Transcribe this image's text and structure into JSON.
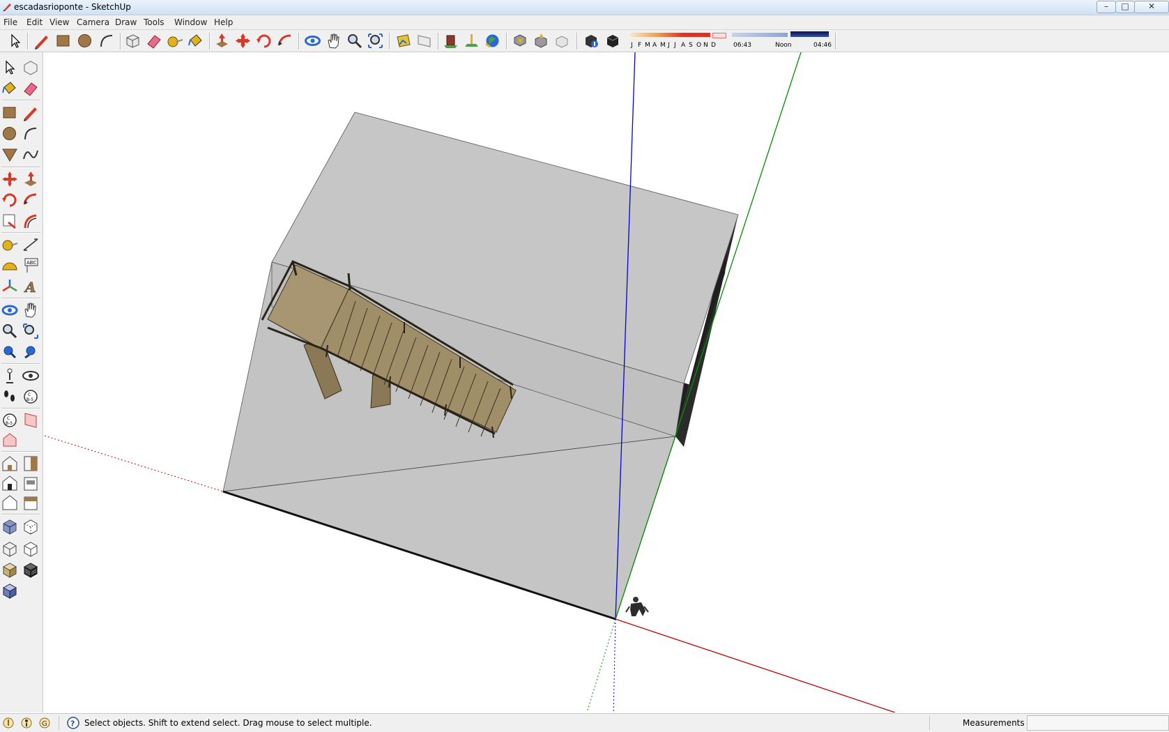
{
  "window": {
    "title": "escadasrioponte - SketchUp",
    "minimize": "–",
    "maximize": "□",
    "close": "✕"
  },
  "menu": [
    "File",
    "Edit",
    "View",
    "Camera",
    "Draw",
    "Tools",
    "Window",
    "Help"
  ],
  "toolbar": {
    "tools": [
      "select",
      "pencil",
      "rectangle",
      "circle",
      "arc",
      "make-component",
      "eraser",
      "tape-measure",
      "paint-bucket",
      "push-pull",
      "move",
      "rotate",
      "follow-me",
      "orbit",
      "pan",
      "zoom",
      "zoom-extents",
      "get-photo-texture",
      "position-camera",
      "warehouse-get",
      "add-location",
      "google-earth-toggle",
      "get-models",
      "share-model",
      "share-component",
      "shadows-toggle",
      "shadow-settings"
    ],
    "shadow": {
      "months": [
        "J",
        "F",
        "M",
        "A",
        "M",
        "J",
        "J",
        "A",
        "S",
        "O",
        "N",
        "D"
      ],
      "time_start": "06:43",
      "time_mid": "Noon",
      "time_end": "04:46"
    }
  },
  "left_toolbar": {
    "tools": [
      "select",
      "make-component",
      "paint-bucket",
      "eraser",
      "rectangle",
      "pencil",
      "circle",
      "arc",
      "polygon",
      "freehand",
      "move",
      "push-pull",
      "rotate",
      "follow-me",
      "scale",
      "offset",
      "tape-measure",
      "dimension",
      "protractor",
      "text",
      "axes",
      "3d-text",
      "orbit",
      "pan",
      "zoom",
      "zoom-window",
      "zoom-extents",
      "previous-view",
      "position-camera",
      "look-around",
      "walk",
      "section-plane",
      "section-display",
      "section-fill",
      "display-section",
      "iso-view",
      "top-view",
      "front-view",
      "right-view",
      "back-view",
      "left-view",
      "xray",
      "wireframe",
      "hidden-line",
      "shaded",
      "shaded-textures",
      "monochrome"
    ]
  },
  "status": {
    "hint": "Select objects. Shift to extend select. Drag mouse to select multiple.",
    "measurements_label": "Measurements",
    "measurements_value": ""
  },
  "colors": {
    "axis_red": "#c00000",
    "axis_green": "#009000",
    "axis_blue": "#0000e0",
    "block_top": "#c4c4c4",
    "block_side": "#2a2a2a",
    "wood": "#9c8b6a"
  }
}
